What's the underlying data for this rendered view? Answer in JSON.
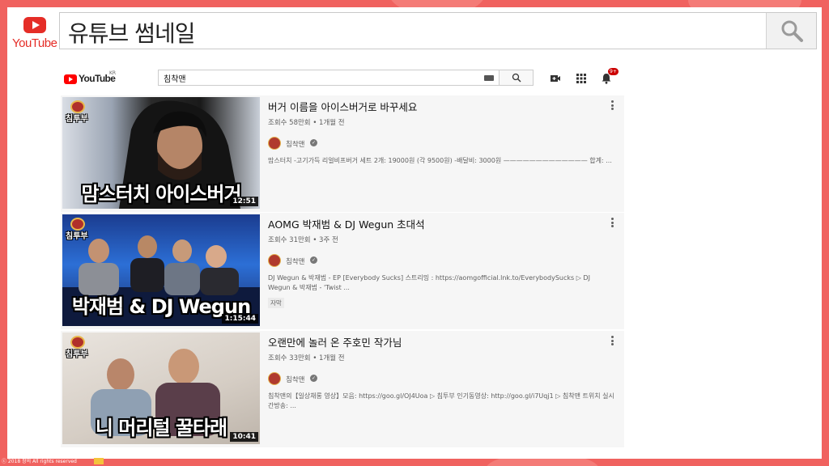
{
  "slide": {
    "title": "유튜브 썸네일",
    "logo_text": "YouTube"
  },
  "youtube": {
    "logo_text": "YouTube",
    "region": "KR",
    "search_query": "침착맨",
    "notification_count": "9+"
  },
  "results": [
    {
      "title": "버거 이름을 아이스버거로 바꾸세요",
      "meta": "조회수 58만회 • 1개월 전",
      "channel": "침착맨",
      "description": "맘스터치 -고기가득 리얼비프버거 세트 2개: 19000원 (각 9500원) -배달비: 3000원 ————————————— 합계: ...",
      "caption_badge": "",
      "duration": "12:51",
      "thumb_text": "맘스터치 아이스버거",
      "thumb_channel_tag": "침투부"
    },
    {
      "title": "AOMG 박재범 & DJ Wegun 초대석",
      "meta": "조회수 31만회 • 3주 전",
      "channel": "침착맨",
      "description": "DJ Wegun & 박재범 - EP [Everybody Sucks] 스트리밍 : https://aomgofficial.lnk.to/EverybodySucks ▷ DJ Wegun & 박재범 - 'Twist ...",
      "caption_badge": "자막",
      "duration": "1:15:44",
      "thumb_text": "박재범 & DJ Wegun",
      "thumb_channel_tag": "침투부"
    },
    {
      "title": "오랜만에 놀러 온 주호민 작가님",
      "meta": "조회수 33만회 • 1개월 전",
      "channel": "침착맨",
      "description": "침착맨의【일상채롱 영상】모음: https://goo.gl/OJ4Uoa ▷ 침투부 인기동영상: http://goo.gl/i7Uqj1 ▷ 침착맨 트위치 실시간방송: ...",
      "caption_badge": "",
      "duration": "10:41",
      "thumb_text": "니 머리털 꿀타래",
      "thumb_channel_tag": "침투부"
    }
  ],
  "footer": {
    "copyright": "ⓒ 2018 창의 All rights reserved"
  },
  "colors": {
    "background": "#f0625f",
    "youtube_red": "#ff0000",
    "text": "#111111",
    "secondary_text": "#606060"
  }
}
